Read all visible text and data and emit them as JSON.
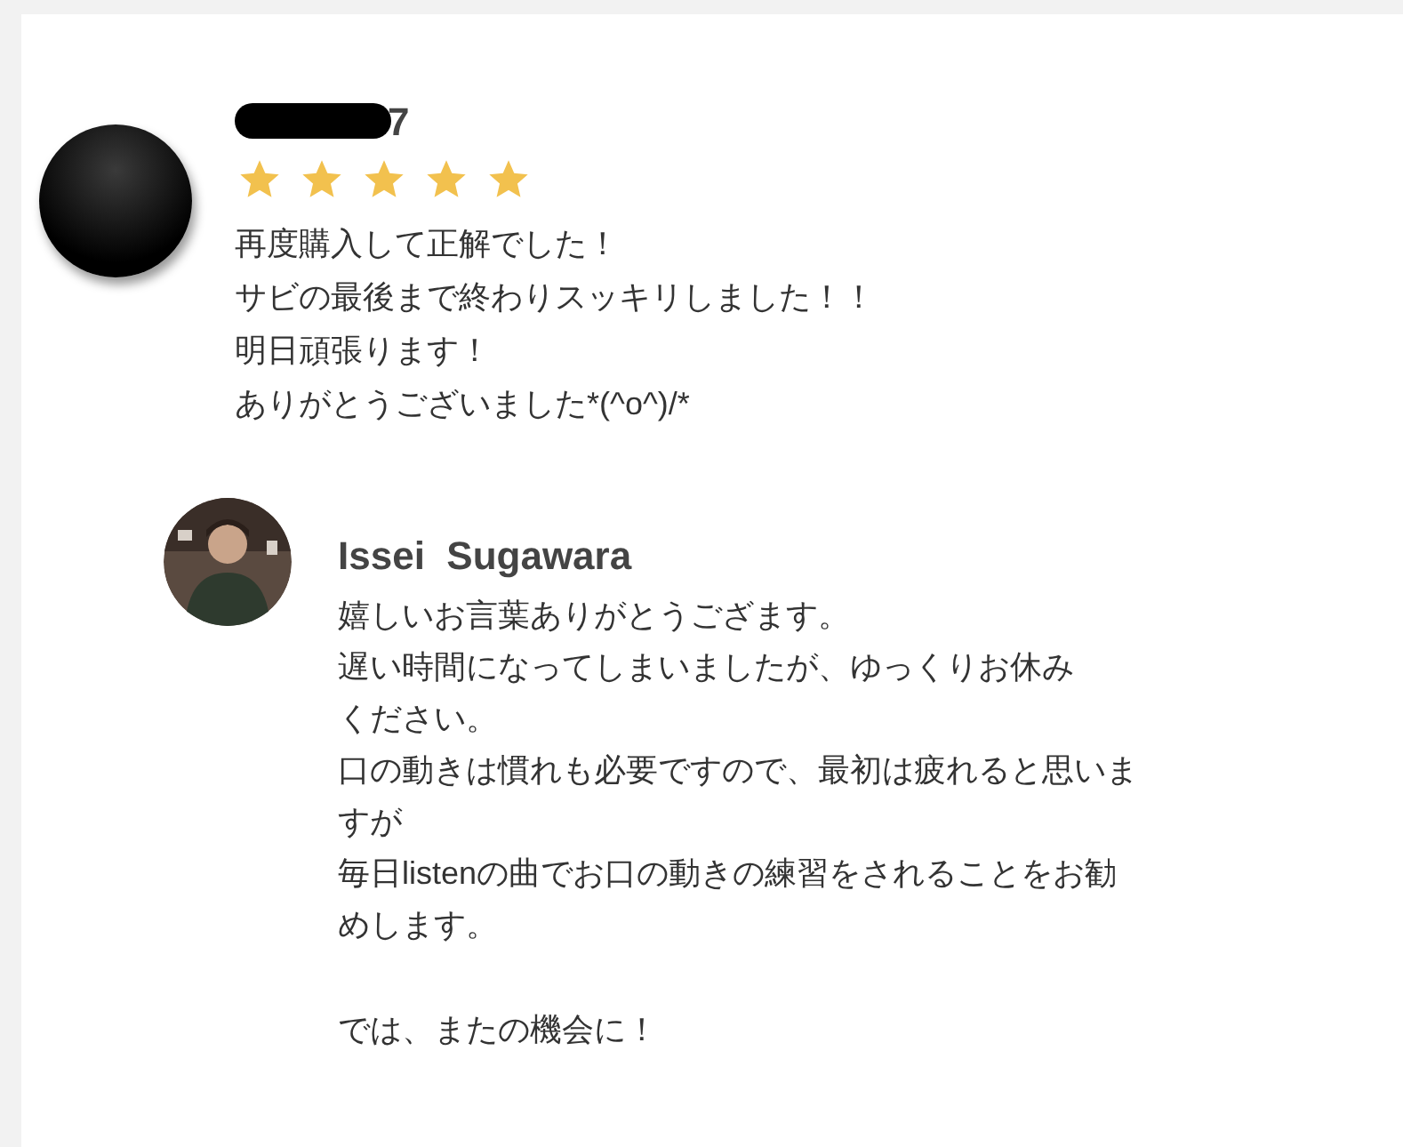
{
  "review": {
    "username": "7",
    "stars": 5,
    "lines": [
      "再度購入して正解でした！",
      "サビの最後まで終わりスッキリしました！！",
      "明日頑張ります！",
      "ありがとうございました*(^o^)/*"
    ]
  },
  "reply": {
    "name": "Issei  Sugawara",
    "paragraphs": [
      [
        "嬉しいお言葉ありがとうござます。",
        "遅い時間になってしまいましたが、ゆっくりお休み",
        "ください。",
        "口の動きは慣れも必要ですので、最初は疲れると思いま",
        "すが",
        "毎日listenの曲でお口の動きの練習をされることをお勧",
        "めします。"
      ],
      [
        "では、またの機会に！"
      ]
    ]
  }
}
